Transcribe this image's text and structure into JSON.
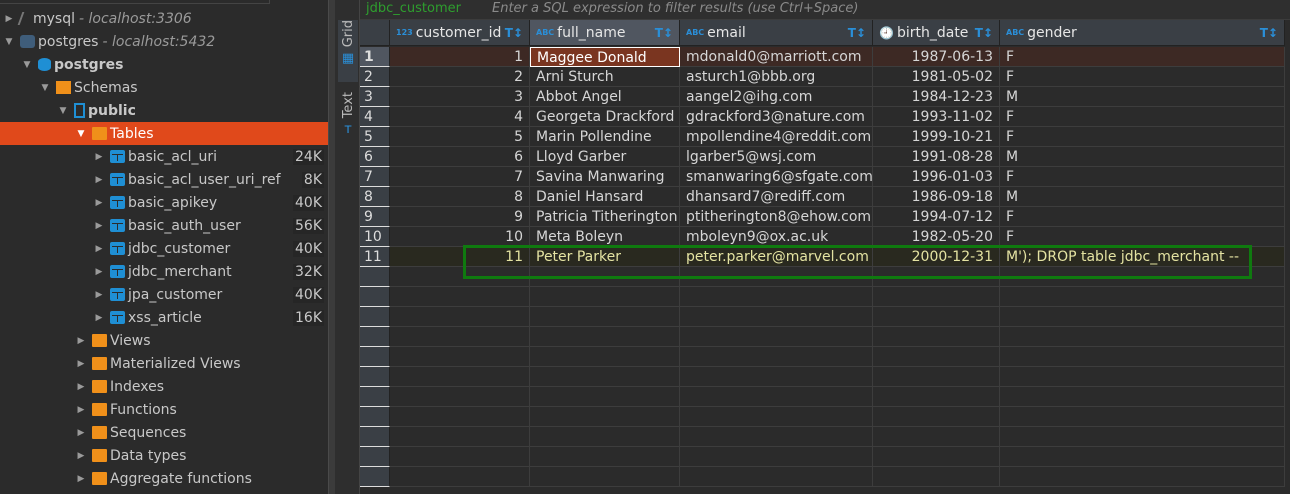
{
  "navigator": {
    "items": [
      {
        "label": "mysql",
        "host": "- localhost:3306",
        "icon": "mysql-icon",
        "level": 0,
        "expanded": false
      },
      {
        "label": "postgres",
        "host": "- localhost:5432",
        "icon": "postgres-icon",
        "level": 0,
        "expanded": true
      },
      {
        "label": "postgres",
        "icon": "database-icon",
        "level": 1,
        "expanded": true,
        "bold": true
      },
      {
        "label": "Schemas",
        "icon": "schemas-folder-icon",
        "level": 2,
        "expanded": true
      },
      {
        "label": "public",
        "icon": "schema-icon",
        "level": 3,
        "expanded": true,
        "bold": true
      },
      {
        "label": "Tables",
        "icon": "tables-folder-icon",
        "level": 4,
        "expanded": true,
        "selected": true
      },
      {
        "label": "basic_acl_uri",
        "size": "24K",
        "icon": "table-icon",
        "level": 5
      },
      {
        "label": "basic_acl_user_uri_ref",
        "size": "8K",
        "icon": "table-icon",
        "level": 5
      },
      {
        "label": "basic_apikey",
        "size": "40K",
        "icon": "table-icon",
        "level": 5
      },
      {
        "label": "basic_auth_user",
        "size": "56K",
        "icon": "table-icon",
        "level": 5
      },
      {
        "label": "jdbc_customer",
        "size": "40K",
        "icon": "table-icon",
        "level": 5
      },
      {
        "label": "jdbc_merchant",
        "size": "32K",
        "icon": "table-icon",
        "level": 5
      },
      {
        "label": "jpa_customer",
        "size": "40K",
        "icon": "table-icon",
        "level": 5
      },
      {
        "label": "xss_article",
        "size": "16K",
        "icon": "table-icon",
        "level": 5
      },
      {
        "label": "Views",
        "icon": "views-folder-icon",
        "level": 4
      },
      {
        "label": "Materialized Views",
        "icon": "views-folder-icon",
        "level": 4
      },
      {
        "label": "Indexes",
        "icon": "folder-icon",
        "level": 4
      },
      {
        "label": "Functions",
        "icon": "folder-icon",
        "level": 4
      },
      {
        "label": "Sequences",
        "icon": "folder-icon",
        "level": 4
      },
      {
        "label": "Data types",
        "icon": "folder-icon",
        "level": 4
      },
      {
        "label": "Aggregate functions",
        "icon": "folder-icon",
        "level": 4
      }
    ]
  },
  "editor": {
    "tab_name": "jdbc_customer",
    "filter_placeholder": "Enter a SQL expression to filter results (use Ctrl+Space)",
    "view_tabs": [
      {
        "label": "Grid",
        "active": true
      },
      {
        "label": "Text",
        "active": false
      }
    ]
  },
  "grid": {
    "columns": [
      {
        "name": "customer_id",
        "type": "123"
      },
      {
        "name": "full_name",
        "type": "ABC"
      },
      {
        "name": "email",
        "type": "ABC"
      },
      {
        "name": "birth_date",
        "type": "clock"
      },
      {
        "name": "gender",
        "type": "ABC"
      }
    ],
    "rows": [
      [
        "1",
        "Maggee Donald",
        "mdonald0@marriott.com",
        "1987-06-13",
        "F"
      ],
      [
        "2",
        "Arni Sturch",
        "asturch1@bbb.org",
        "1981-05-02",
        "F"
      ],
      [
        "3",
        "Abbot Angel",
        "aangel2@ihg.com",
        "1984-12-23",
        "M"
      ],
      [
        "4",
        "Georgeta Drackford",
        "gdrackford3@nature.com",
        "1993-11-02",
        "F"
      ],
      [
        "5",
        "Marin Pollendine",
        "mpollendine4@reddit.com",
        "1999-10-21",
        "F"
      ],
      [
        "6",
        "Lloyd Garber",
        "lgarber5@wsj.com",
        "1991-08-28",
        "M"
      ],
      [
        "7",
        "Savina Manwaring",
        "smanwaring6@sfgate.com",
        "1996-01-03",
        "F"
      ],
      [
        "8",
        "Daniel Hansard",
        "dhansard7@rediff.com",
        "1986-09-18",
        "M"
      ],
      [
        "9",
        "Patricia Titherington",
        "ptitherington8@ehow.com",
        "1994-07-12",
        "F"
      ],
      [
        "10",
        "Meta Boleyn",
        "mboleyn9@ox.ac.uk",
        "1982-05-20",
        "F"
      ],
      [
        "11",
        "Peter Parker",
        "peter.parker@marvel.com",
        "2000-12-31",
        "M'); DROP table jdbc_merchant --"
      ]
    ],
    "selected_row": 1,
    "highlight_color": "#0f7a0f",
    "selection_color": "#e0491b"
  }
}
